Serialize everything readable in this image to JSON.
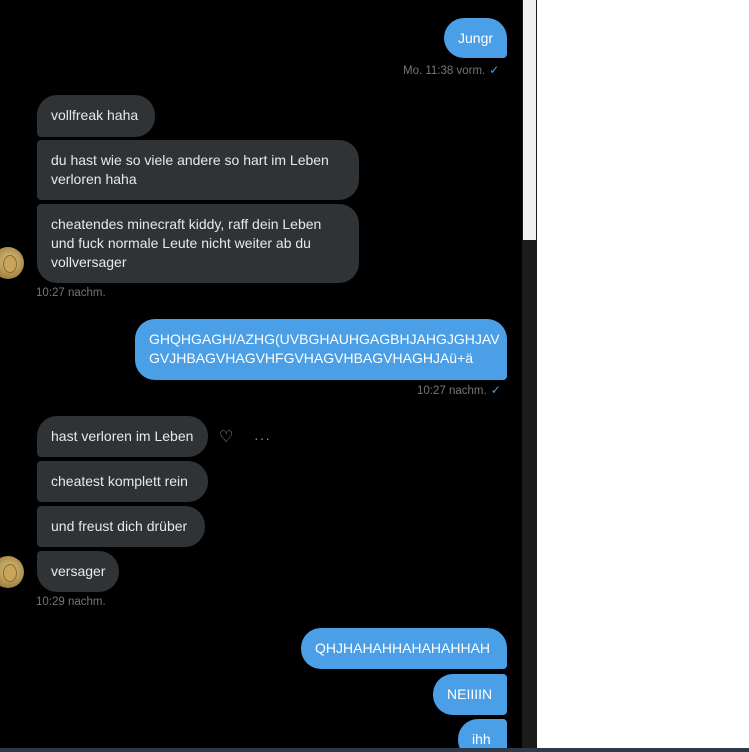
{
  "messages": [
    {
      "text": "Jungr"
    },
    {
      "text": "vollfreak haha"
    },
    {
      "text": "du hast wie so viele andere so hart im Leben\nverloren haha"
    },
    {
      "text": "cheatendes minecraft kiddy, raff dein Leben\nund fuck normale Leute nicht weiter ab du\nvollversager"
    },
    {
      "text": "GHQHGAGH/AZHG(UVBGHAUHGAGBHJAHGJGHJAV\nGVJHBAGVHAGVHFGVHAGVHBAGVHAGHJAü+ä"
    },
    {
      "text": "hast verloren im Leben"
    },
    {
      "text": "cheatest komplett rein"
    },
    {
      "text": "und freust dich drüber"
    },
    {
      "text": "versager"
    },
    {
      "text": "QHJHAHAHHAHAHAHHAH"
    },
    {
      "text": "NEIIIIN"
    },
    {
      "text": "ihh"
    }
  ],
  "timestamps": {
    "t1": "Mo. 11:38 vorm.",
    "t2": "10:27 nachm.",
    "t3": "10:27 nachm.",
    "t4": "10:29 nachm."
  },
  "icons": {
    "check": "✓",
    "react": "♡",
    "more": "···"
  },
  "colors": {
    "outgoing": "#4a9fe6",
    "incoming": "#2f3336",
    "background": "#000000"
  }
}
